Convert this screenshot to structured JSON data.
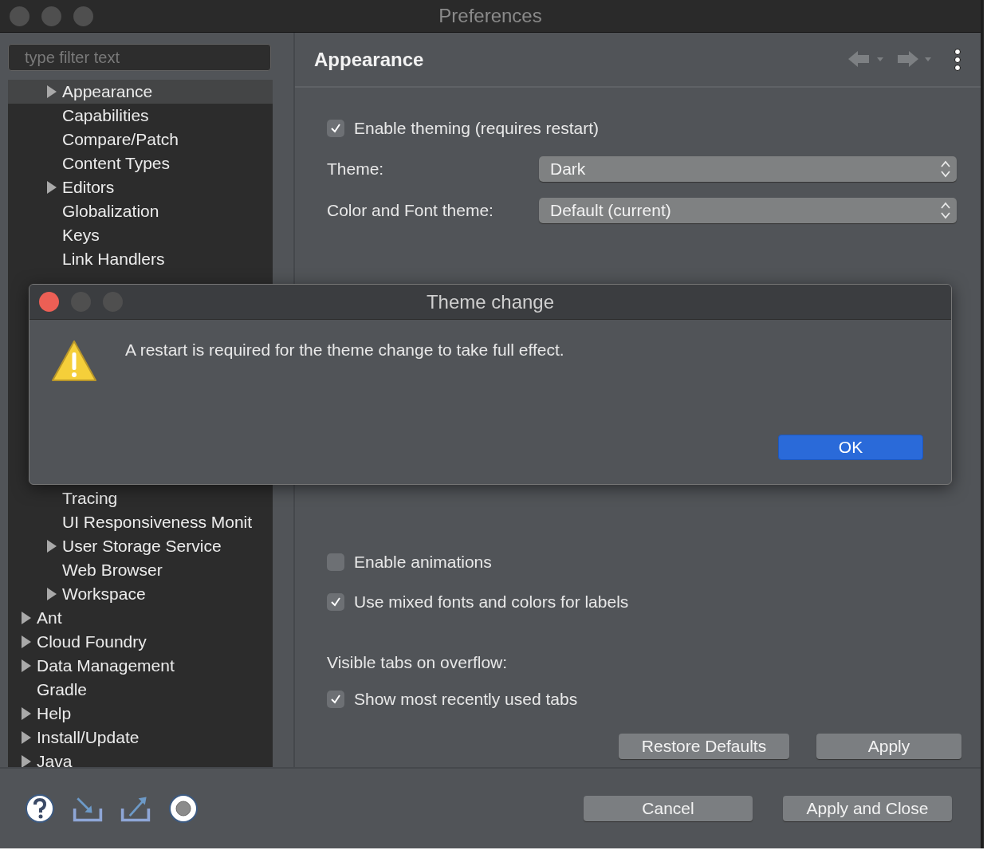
{
  "window": {
    "title": "Preferences"
  },
  "filter": {
    "placeholder": "type filter text"
  },
  "tree": [
    {
      "children": [
        {
          "label": "Appearance",
          "expandable": true,
          "selected": true
        },
        {
          "label": "Capabilities",
          "expandable": false,
          "selected": false
        },
        {
          "label": "Compare/Patch",
          "expandable": false,
          "selected": false
        },
        {
          "label": "Content Types",
          "expandable": false,
          "selected": false
        },
        {
          "label": "Editors",
          "expandable": true,
          "selected": false
        },
        {
          "label": "Globalization",
          "expandable": false,
          "selected": false
        },
        {
          "label": "Keys",
          "expandable": false,
          "selected": false
        },
        {
          "label": "Link Handlers",
          "expandable": false,
          "selected": false
        },
        {
          "label": "Tracing",
          "expandable": false,
          "selected": false
        },
        {
          "label": "UI Responsiveness Monit",
          "expandable": false,
          "selected": false
        },
        {
          "label": "User Storage Service",
          "expandable": true,
          "selected": false
        },
        {
          "label": "Web Browser",
          "expandable": false,
          "selected": false
        },
        {
          "label": "Workspace",
          "expandable": true,
          "selected": false
        }
      ]
    },
    {
      "label": "Ant",
      "expandable": true,
      "selected": false
    },
    {
      "label": "Cloud Foundry",
      "expandable": true,
      "selected": false
    },
    {
      "label": "Data Management",
      "expandable": true,
      "selected": false
    },
    {
      "label": "Gradle",
      "expandable": false,
      "selected": false
    },
    {
      "label": "Help",
      "expandable": true,
      "selected": false
    },
    {
      "label": "Install/Update",
      "expandable": true,
      "selected": false
    },
    {
      "label": "Java",
      "expandable": true,
      "selected": false
    }
  ],
  "page": {
    "title": "Appearance",
    "settings": [
      {
        "kind": "checkbox",
        "label": "Enable theming (requires restart)",
        "checked": true
      },
      {
        "kind": "select",
        "label": "Theme:",
        "value": "Dark"
      },
      {
        "kind": "select",
        "label": "Color and Font theme:",
        "value": "Default (current)"
      },
      {
        "kind": "checkbox",
        "label": "Enable animations",
        "checked": false
      },
      {
        "kind": "checkbox",
        "label": "Use mixed fonts and colors for labels",
        "checked": true
      },
      {
        "kind": "heading",
        "label": "Visible tabs on overflow:"
      },
      {
        "kind": "checkbox",
        "label": "Show most recently used tabs",
        "checked": true
      }
    ],
    "buttons": [
      "Restore Defaults",
      "Apply"
    ]
  },
  "footer_buttons": [
    "Cancel",
    "Apply and Close"
  ],
  "dialog": {
    "title": "Theme change",
    "message": "A restart is required for the theme change to take full effect.",
    "buttons": [
      "OK"
    ]
  }
}
